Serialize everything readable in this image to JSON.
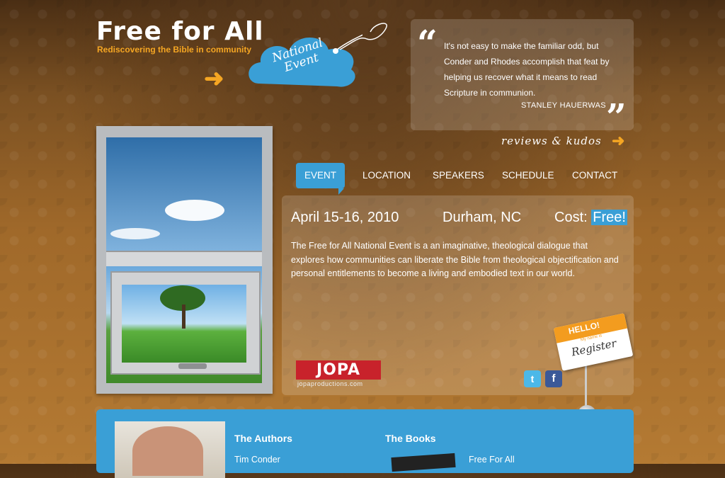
{
  "header": {
    "title": "Free for All",
    "tagline": "Rediscovering the Bible in community",
    "cloud_label": "National Event"
  },
  "quote": {
    "text": "It's not easy to make the familiar odd, but Conder and Rhodes accomplish that feat by helping us recover what it means to read Scripture in communion.",
    "author": "STANLEY HAUERWAS",
    "reviews_link": "reviews & kudos"
  },
  "nav": {
    "items": [
      {
        "label": "EVENT",
        "active": true
      },
      {
        "label": "LOCATION",
        "active": false
      },
      {
        "label": "SPEAKERS",
        "active": false
      },
      {
        "label": "SCHEDULE",
        "active": false
      },
      {
        "label": "CONTACT",
        "active": false
      }
    ]
  },
  "event": {
    "date": "April 15-16, 2010",
    "city": "Durham, NC",
    "cost_label": "Cost:",
    "cost_value": "Free!",
    "description": "The Free for All National Event is a an imaginative, theological dialogue that explores how communities can liberate the Bible from theological objectification and personal entitlements to become a living and embodied text in our world."
  },
  "sponsor": {
    "logo": "JOPA",
    "url": "jopaproductions.com"
  },
  "social": {
    "twitter": "t",
    "facebook": "f"
  },
  "register_tag": {
    "hello": "HELLO!",
    "my_name_is": "My name is",
    "name": "Register"
  },
  "bottom": {
    "authors_title": "The Authors",
    "authors": [
      "Tim Conder"
    ],
    "books_title": "The Books",
    "books": [
      "Free For All"
    ]
  },
  "colors": {
    "accent_blue": "#3a9fd6",
    "accent_orange": "#f5a623",
    "jopa_red": "#c8222b"
  }
}
